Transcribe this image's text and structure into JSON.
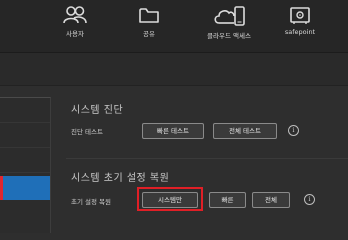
{
  "topnav": {
    "items": [
      {
        "label": "사용자",
        "icon": "users-icon"
      },
      {
        "label": "공유",
        "icon": "folder-icon"
      },
      {
        "label": "클라우드 액세스",
        "icon": "cloud-access-icon"
      },
      {
        "label": "safepoint",
        "icon": "safe-icon"
      }
    ]
  },
  "diagnostics": {
    "title": "시스템 진단",
    "row_label": "진단 테스트",
    "quick_test_label": "빠른 테스트",
    "full_test_label": "전체 테스트",
    "info_glyph": "i"
  },
  "restore": {
    "title": "시스템 초기 설정 복원",
    "row_label": "초기 설정 복원",
    "system_only_label": "시스템만",
    "quick_label": "빠른",
    "full_label": "전체",
    "info_glyph": "i"
  },
  "colors": {
    "highlight": "#e01f26",
    "active_sidebar": "#1f6fb8",
    "background": "#2e2e2e"
  }
}
